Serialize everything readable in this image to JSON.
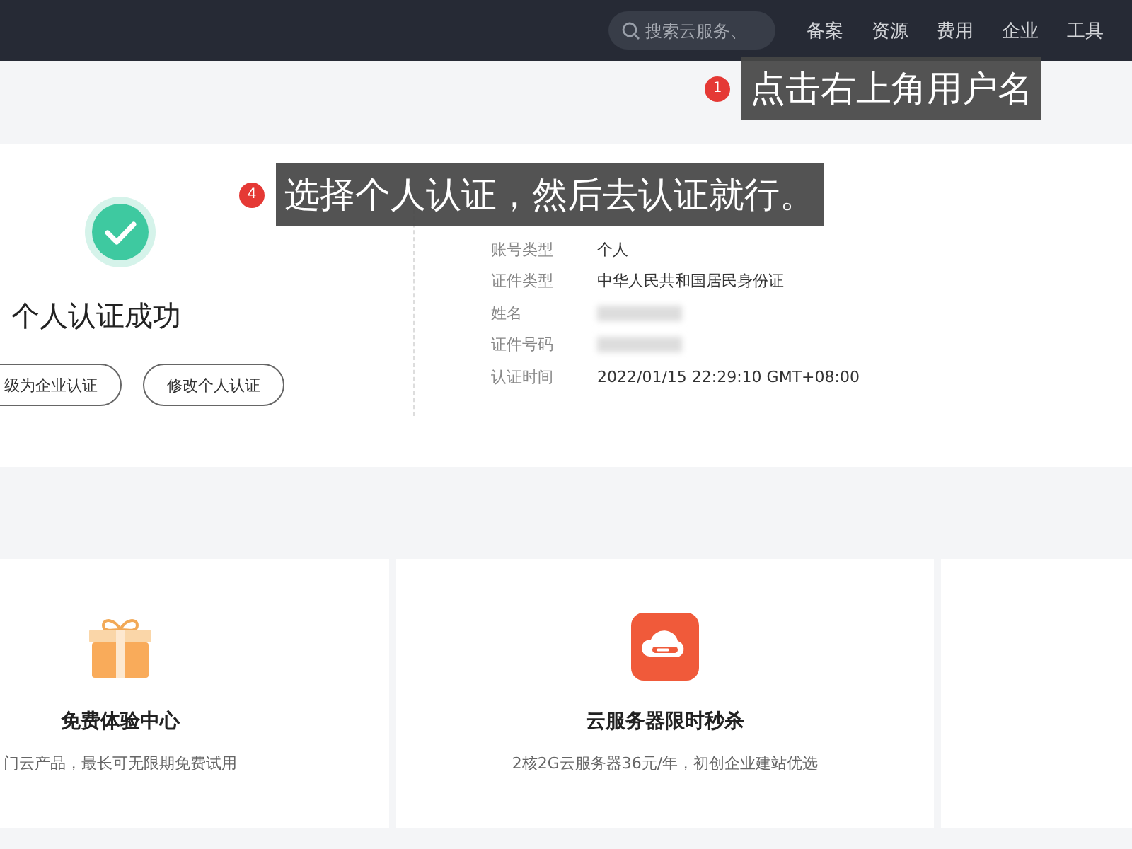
{
  "top_nav": {
    "search": {
      "placeholder": "搜索云服务、"
    },
    "items": [
      {
        "label": "备案"
      },
      {
        "label": "资源"
      },
      {
        "label": "费用"
      },
      {
        "label": "企业"
      },
      {
        "label": "工具"
      }
    ]
  },
  "annotations": [
    {
      "number": "1",
      "text": "点击右上角用户名"
    },
    {
      "number": "4",
      "text": "选择个人认证，然后去认证就行。"
    }
  ],
  "verification": {
    "status_title": "个人认证成功",
    "buttons": [
      {
        "label": "级为企业认证"
      },
      {
        "label": "修改个人认证"
      }
    ],
    "fields": [
      {
        "label": "账号类型",
        "value": "个人",
        "blurred": false
      },
      {
        "label": "证件类型",
        "value": "中华人民共和国居民身份证",
        "blurred": false
      },
      {
        "label": "姓名",
        "blurred": true
      },
      {
        "label": "证件号码",
        "blurred": true
      },
      {
        "label": "认证时间",
        "value": "2022/01/15 22:29:10 GMT+08:00",
        "blurred": false
      }
    ]
  },
  "cards": [
    {
      "kind": "gift",
      "title": "免费体验中心",
      "description": "门云产品，最长可无限期免费试用"
    },
    {
      "kind": "cloud",
      "title": "云服务器限时秒杀",
      "description": "2核2G云服务器36元/年，初创企业建站优选"
    },
    {
      "kind": "empty"
    }
  ]
}
